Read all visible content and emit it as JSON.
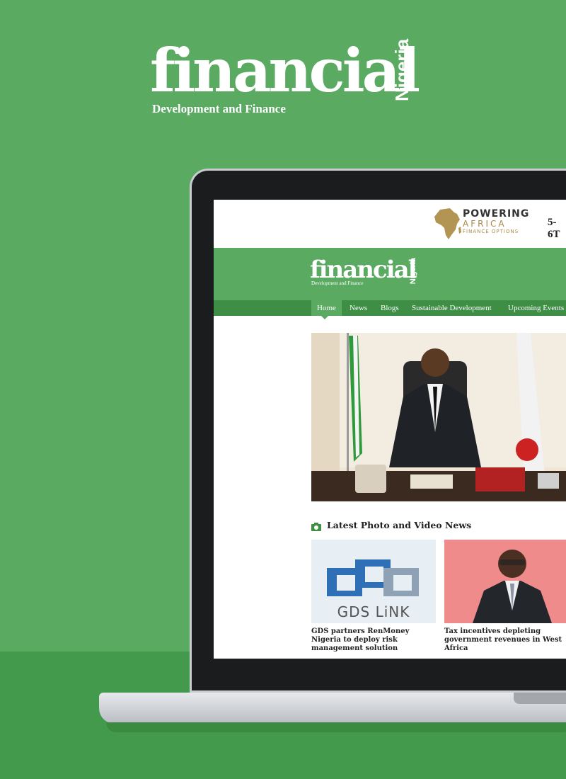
{
  "hero": {
    "brand_word": "financial",
    "brand_country": "Nigeria",
    "tagline": "Development and Finance"
  },
  "ad_banner": {
    "line1": "POWERING",
    "line2": "AFRICA",
    "line3": "FINANCE OPTIONS",
    "date_fragment": "5-6T"
  },
  "site": {
    "brand_word": "financial",
    "brand_country": "Nigeria",
    "tagline": "Development and Finance"
  },
  "nav": {
    "items": [
      "Home",
      "News",
      "Blogs",
      "Sustainable Development",
      "Upcoming Events"
    ],
    "active": "Home"
  },
  "section": {
    "title": "Latest Photo and Video News"
  },
  "cards": [
    {
      "caption": "GDS partners RenMoney Nigeria to deploy risk management solution",
      "logo_text": "GDS LiNK"
    },
    {
      "caption": "Tax incentives depleting government revenues in West Africa"
    }
  ],
  "colors": {
    "brand_green": "#5aaa62",
    "nav_green": "#3e8e46",
    "floor_green": "#449a4c",
    "gold": "#a8894a"
  }
}
